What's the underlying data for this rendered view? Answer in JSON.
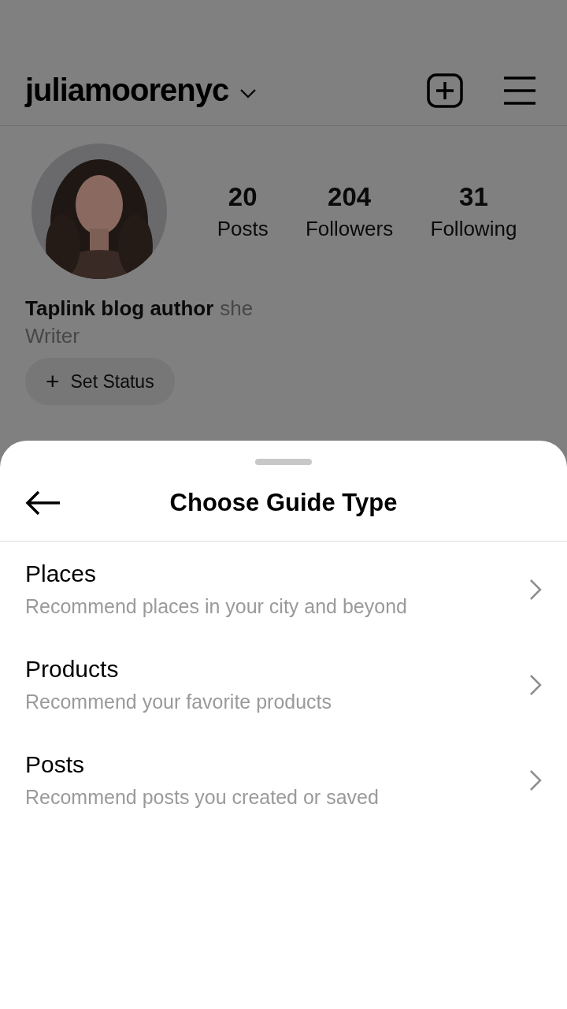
{
  "profile": {
    "username": "juliamoorenyc",
    "stats": [
      {
        "value": "20",
        "label": "Posts"
      },
      {
        "value": "204",
        "label": "Followers"
      },
      {
        "value": "31",
        "label": "Following"
      }
    ],
    "name": "Taplink blog author",
    "pronouns": "she",
    "category": "Writer",
    "status_button": {
      "icon": "+",
      "label": "Set Status"
    }
  },
  "sheet": {
    "title": "Choose Guide Type",
    "options": [
      {
        "title": "Places",
        "subtitle": "Recommend places in your city and beyond"
      },
      {
        "title": "Products",
        "subtitle": "Recommend your favorite products"
      },
      {
        "title": "Posts",
        "subtitle": "Recommend posts you created or saved"
      }
    ]
  }
}
